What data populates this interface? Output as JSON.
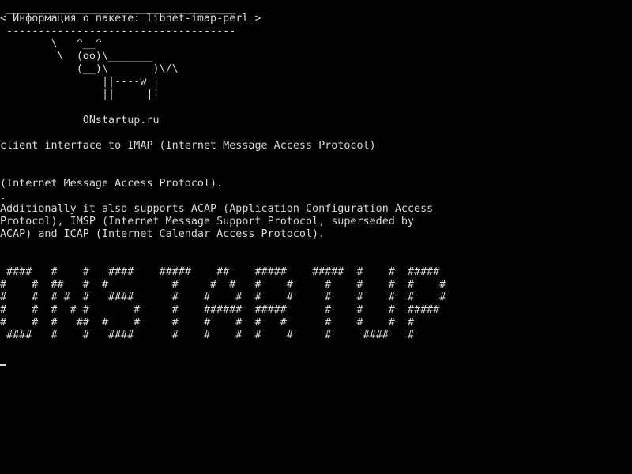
{
  "terminal": {
    "foreground": "#d8d8d8",
    "background": "#000000",
    "lines": [
      " ____________________________________",
      "< Информация о пакете: libnet-imap-perl >",
      " ------------------------------------",
      "        \\   ^__^",
      "         \\  (oo)\\_______",
      "            (__)\\       )\\/\\",
      "                ||----w |",
      "                ||     ||",
      "",
      "             ONstartup.ru",
      "",
      "client interface to IMAP (Internet Message Access Protocol)",
      "",
      "",
      "(Internet Message Access Protocol).",
      ".",
      "Additionally it also supports ACAP (Application Configuration Access",
      "Protocol), IMSP (Internet Message Support Protocol, superseded by",
      "ACAP) and ICAP (Internet Calendar Access Protocol).",
      "",
      "",
      " ####   #    #   ####    #####    ##    #####    #####  #    #  #####",
      "#    #  ##   #  #          #     #  #   #    #     #    #    #  #    #",
      "#    #  # #  #   ####      #    #    #  #    #     #    #    #  #    #",
      "#    #  #  # #       #     #    ######  #####      #    #    #  #####",
      "#    #  #   ##  #    #     #    #    #  #   #      #    #    #  #",
      " ####   #    #   ####      #    #    #  #    #     #     ####   #"
    ]
  }
}
